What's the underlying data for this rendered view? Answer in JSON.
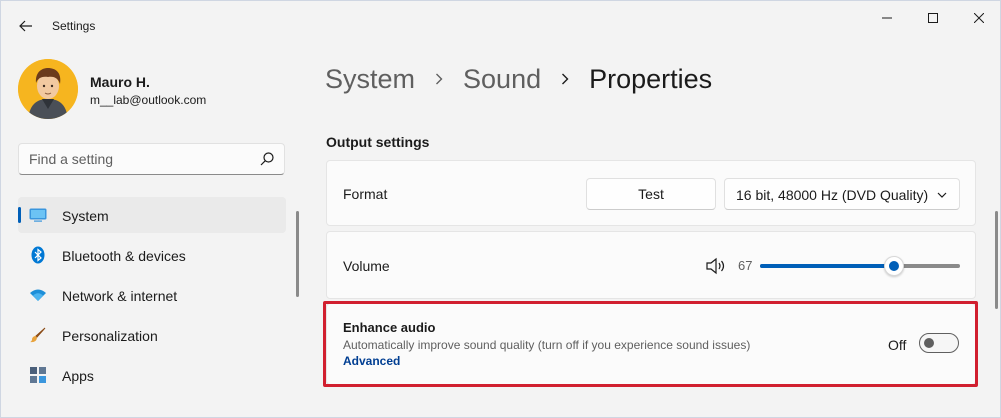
{
  "window": {
    "title": "Settings",
    "controls": [
      "minimize-icon",
      "maximize-icon",
      "close-icon"
    ]
  },
  "profile": {
    "name": "Mauro H.",
    "email": "m__lab@outlook.com"
  },
  "search": {
    "placeholder": "Find a setting",
    "value": ""
  },
  "sidebar": {
    "items": [
      {
        "label": "System",
        "icon": "monitor-icon",
        "active": true
      },
      {
        "label": "Bluetooth & devices",
        "icon": "bluetooth-icon",
        "active": false
      },
      {
        "label": "Network & internet",
        "icon": "wifi-icon",
        "active": false
      },
      {
        "label": "Personalization",
        "icon": "brush-icon",
        "active": false
      },
      {
        "label": "Apps",
        "icon": "apps-icon",
        "active": false
      }
    ]
  },
  "breadcrumb": [
    "System",
    "Sound",
    "Properties"
  ],
  "output_settings": {
    "title": "Output settings",
    "format": {
      "label": "Format",
      "test_button": "Test",
      "selected": "16 bit, 48000 Hz (DVD Quality)"
    },
    "volume": {
      "label": "Volume",
      "value": "67",
      "level": 0.67
    },
    "enhance": {
      "title": "Enhance audio",
      "description": "Automatically improve sound quality (turn off if you experience sound issues)",
      "link": "Advanced",
      "state_label": "Off",
      "enabled": false
    }
  },
  "colors": {
    "accent": "#005fb8",
    "highlight": "#d11f2f",
    "background": "#f3f3f3",
    "card": "#fbfbfb"
  }
}
